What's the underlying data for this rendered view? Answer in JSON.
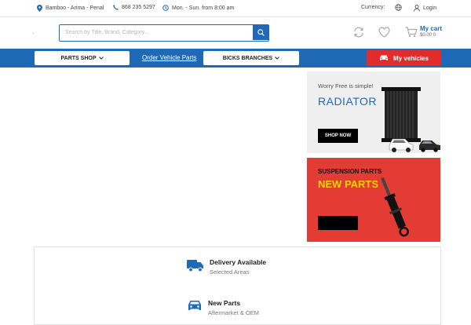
{
  "topbar": {
    "location": "Bamboo - Arima - Penal",
    "phone": "868 235 5297",
    "hours": "Mon. - Sun. from 8:00 am",
    "currency_label": "Currency:",
    "login_label": "Login"
  },
  "header": {
    "search_placeholder": "Search by Title, Brand, Category...",
    "cart_label": "My cart",
    "cart_summary": "$0.00 0"
  },
  "nav": {
    "parts_shop": "PARTS SHOP",
    "order_vehicle_parts": "Order Vehicle Parts",
    "bicks_branches": "BICKS BRANCHES",
    "my_vehicles": "My vehicles"
  },
  "banners": {
    "radiator": {
      "tagline": "Worry Free is simple!",
      "title": "RADIATOR",
      "button": "SHOP NOW"
    },
    "suspension": {
      "tagline": "SUSPENSION PARTS",
      "title": "NEW PARTS"
    }
  },
  "features": [
    {
      "title": "Delivery Available",
      "subtitle": "Selected Areas",
      "icon": "truck-icon"
    },
    {
      "title": "New Parts",
      "subtitle": "Aftermarket & OEM",
      "icon": "car-icon"
    }
  ],
  "colors": {
    "brand_blue": "#1f69b7",
    "accent_red": "#e32b2b",
    "banner_red": "#e43b35",
    "banner_yellow": "#ffd200"
  }
}
